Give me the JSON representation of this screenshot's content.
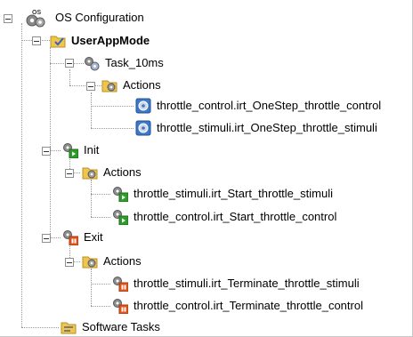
{
  "tree": {
    "root": {
      "label": "OS Configuration",
      "icon": "os-config-icon",
      "badge": "OS"
    },
    "usermode": {
      "label": "UserAppMode",
      "icon": "folder-check-icon"
    },
    "task": {
      "label": "Task_10ms",
      "icon": "gears-icon"
    },
    "task_actions": {
      "label": "Actions",
      "icon": "folder-gears-icon"
    },
    "task_items": [
      {
        "label": "throttle_control.irt_OneStep_throttle_control",
        "icon": "step-action-icon"
      },
      {
        "label": "throttle_stimuli.irt_OneStep_throttle_stimuli",
        "icon": "step-action-icon"
      }
    ],
    "init": {
      "label": "Init",
      "icon": "gears-play-icon"
    },
    "init_actions": {
      "label": "Actions",
      "icon": "folder-gears-icon"
    },
    "init_items": [
      {
        "label": "throttle_stimuli.irt_Start_throttle_stimuli",
        "icon": "start-action-icon"
      },
      {
        "label": "throttle_control.irt_Start_throttle_control",
        "icon": "start-action-icon"
      }
    ],
    "exit": {
      "label": "Exit",
      "icon": "gears-stop-icon"
    },
    "exit_actions": {
      "label": "Actions",
      "icon": "folder-gears-icon"
    },
    "exit_items": [
      {
        "label": "throttle_stimuli.irt_Terminate_throttle_stimuli",
        "icon": "terminate-action-icon"
      },
      {
        "label": "throttle_control.irt_Terminate_throttle_control",
        "icon": "terminate-action-icon"
      }
    ],
    "software_tasks": {
      "label": "Software Tasks",
      "icon": "folder-tasks-icon"
    }
  },
  "colors": {
    "play": "#2e9c2a",
    "stop": "#e0561e",
    "folder": "#f0c64a",
    "step": "#3d78c8",
    "lines": "#9a9a9a"
  }
}
